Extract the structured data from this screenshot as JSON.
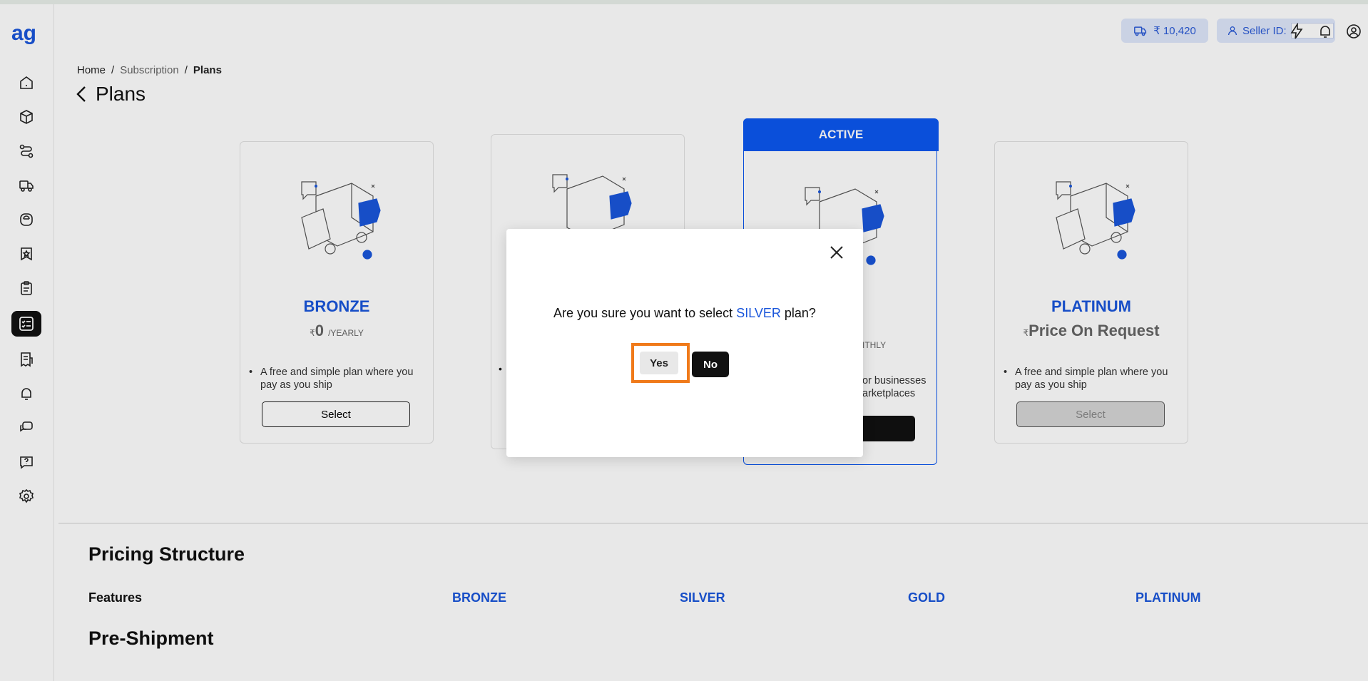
{
  "header": {
    "wallet_amount": "₹ 10,420",
    "seller_label": "Seller ID:"
  },
  "sidebar": {
    "logo": "ag",
    "items": [
      {
        "icon": "home-icon"
      },
      {
        "icon": "package-icon"
      },
      {
        "icon": "route-icon"
      },
      {
        "icon": "truck-icon"
      },
      {
        "icon": "support-icon"
      },
      {
        "icon": "badge-icon"
      },
      {
        "icon": "clipboard-icon"
      },
      {
        "icon": "checklist-icon",
        "active": true
      },
      {
        "icon": "invoice-icon"
      },
      {
        "icon": "bell-icon"
      },
      {
        "icon": "chat-icon"
      },
      {
        "icon": "help-icon"
      },
      {
        "icon": "gear-icon"
      }
    ]
  },
  "breadcrumb": {
    "home": "Home",
    "sep1": "/",
    "subscription": "Subscription",
    "sep2": "/",
    "current": "Plans"
  },
  "page": {
    "title": "Plans"
  },
  "plans": {
    "bronze": {
      "name": "BRONZE",
      "currency": "₹",
      "price": "0",
      "period": "/YEARLY",
      "description": "A free and simple plan where you pay as you ship",
      "select_label": "Select"
    },
    "silver": {
      "visible_desc": ""
    },
    "gold": {
      "banner": "ACTIVE",
      "period_fragment": "ITHLY",
      "desc_line1": "or businesses",
      "desc_line2": "arketplaces"
    },
    "platinum": {
      "name": "PLATINUM",
      "currency": "₹",
      "price": "Price On Request",
      "description": "A free and simple plan where you pay as you ship",
      "select_label": "Select"
    }
  },
  "pricing": {
    "title": "Pricing Structure",
    "features_label": "Features",
    "columns": [
      "BRONZE",
      "SILVER",
      "GOLD",
      "PLATINUM"
    ],
    "section": "Pre-Shipment"
  },
  "modal": {
    "question_prefix": "Are you sure you want to select ",
    "question_plan": "SILVER",
    "question_suffix": " plan?",
    "yes_label": "Yes",
    "no_label": "No"
  },
  "colors": {
    "accent": "#1a56db",
    "active_banner": "#0b57f0",
    "highlight_border": "#f07a1a"
  }
}
